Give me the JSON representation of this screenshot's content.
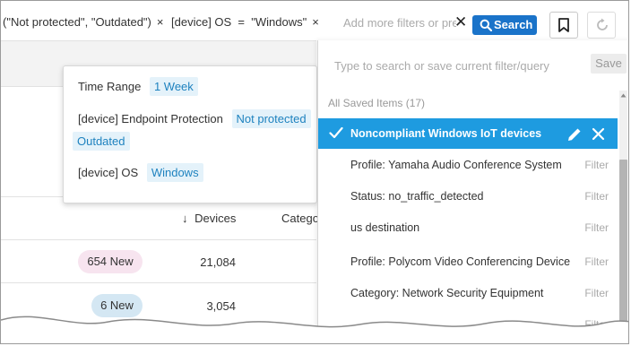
{
  "filter_bar": {
    "chip1_text": "(\"Not protected\", \"Outdated\")",
    "chip2_text": "[device] OS  =  \"Windows\"",
    "chip_remove_glyph": "×",
    "add_filter_placeholder": "Add more filters or press \"Enter\"",
    "clear_glyph": "✕",
    "search_label": "Search"
  },
  "table": {
    "columns": {
      "devices": "Devices",
      "category": "Catego"
    },
    "sort_arrow": "↓",
    "rows": [
      {
        "badge": "654 New",
        "devices": "21,084"
      },
      {
        "badge": "6 New",
        "devices": "3,054"
      }
    ]
  },
  "popover": {
    "rows": [
      {
        "label": "Time Range",
        "values": [
          "1 Week"
        ]
      },
      {
        "label": "[device] Endpoint Protection",
        "values": [
          "Not protected",
          "Outdated"
        ]
      },
      {
        "label": "[device] OS",
        "values": [
          "Windows"
        ]
      }
    ]
  },
  "saved_panel": {
    "query_placeholder": "Type to search or save current filter/query",
    "save_label": "Save",
    "saved_header": "All Saved Items (17)",
    "filter_action": "Filter",
    "items": [
      {
        "label": "Noncompliant Windows IoT devices",
        "selected": true
      },
      {
        "label": "Profile: Yamaha Audio Conference System"
      },
      {
        "label": "Status: no_traffic_detected"
      },
      {
        "label": "us destination"
      },
      {
        "label": "Profile: Polycom Video Conferencing Device"
      },
      {
        "label": "Category: Network Security Equipment"
      },
      {
        "label": ""
      }
    ]
  },
  "colors": {
    "accent": "#1e9be0",
    "search_button": "#1a73c9",
    "tag_bg": "#e4f2fa",
    "tag_text": "#1e82bf",
    "badge_new_pink": "#f7e4ef",
    "badge_new_blue": "#d4e7f3"
  },
  "icons": {
    "search": "magnifier-icon",
    "bookmark": "bookmark-icon",
    "refresh": "refresh-icon",
    "check": "check-icon",
    "edit": "pencil-icon",
    "close": "close-icon"
  }
}
